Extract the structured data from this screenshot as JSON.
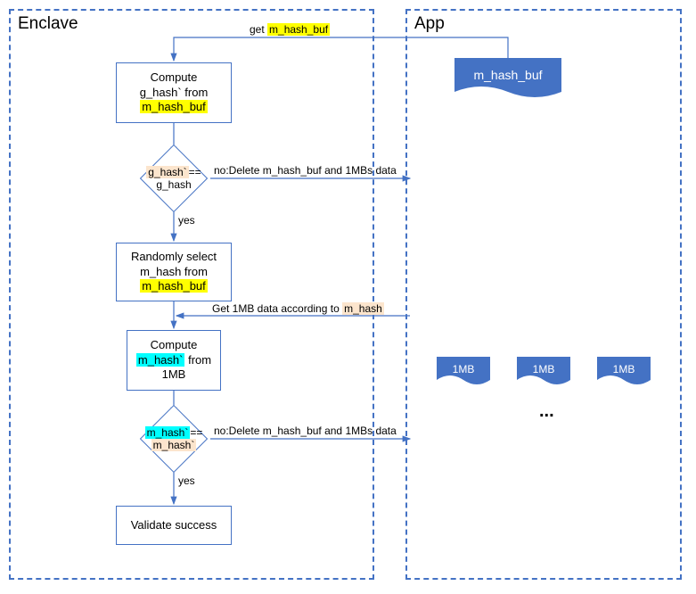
{
  "zones": {
    "enclave": {
      "title": "Enclave"
    },
    "app": {
      "title": "App"
    }
  },
  "labels": {
    "get_prefix": "get",
    "get_target": "m_hash_buf",
    "hash_buf_doc": "m_hash_buf",
    "block": "1MB",
    "ellipsis": "..."
  },
  "steps": {
    "compute_g": {
      "l1": "Compute",
      "l2": "g_hash` from",
      "hl": "m_hash_buf"
    },
    "decision1": {
      "left": "g_hash`",
      "mid": "== g_hash"
    },
    "select_m": {
      "l1": "Randomly select",
      "l2": "m_hash from",
      "hl": "m_hash_buf"
    },
    "compute_m": {
      "l1": "Compute",
      "hl": "m_hash`",
      "l2": "from",
      "l3": "1MB"
    },
    "decision2": {
      "left": "m_hash`",
      "mid_left": "==",
      "mid_right": "m_hash`"
    },
    "success": {
      "text": "Validate success"
    }
  },
  "edge_labels": {
    "yes": "yes",
    "no_delete": "no:Delete m_hash_buf and 1MBs data",
    "get_1mb_pre": "Get 1MB data according to",
    "get_1mb_hl": "m_hash"
  }
}
